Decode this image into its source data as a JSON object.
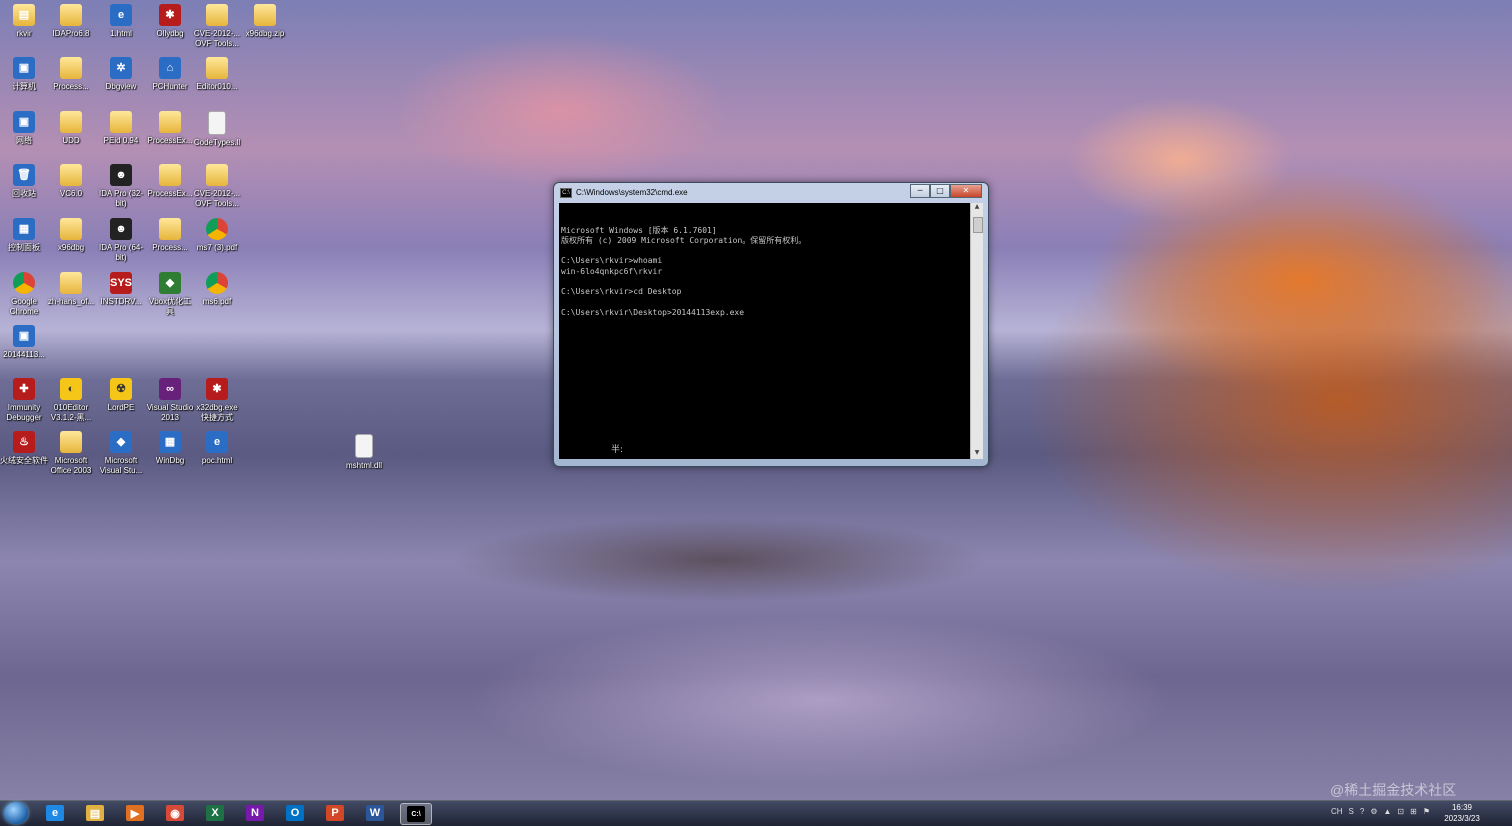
{
  "desktop": {
    "icons": [
      {
        "label": "rkvir",
        "glyph": "▤",
        "style": "folder"
      },
      {
        "label": "IDAPro6.8",
        "glyph": "",
        "style": "folder"
      },
      {
        "label": "1.html",
        "glyph": "e",
        "style": "app-blue"
      },
      {
        "label": "Ollydbg",
        "glyph": "✱",
        "style": "app-red"
      },
      {
        "label": "CVE-2012-... OVF Tools...",
        "glyph": "",
        "style": "folder"
      },
      {
        "label": "x96dbg.zip",
        "glyph": "",
        "style": "folder"
      },
      {
        "label": "计算机",
        "glyph": "▣",
        "style": "app-blue"
      },
      {
        "label": "Process...",
        "glyph": "",
        "style": "folder"
      },
      {
        "label": "Dbgview",
        "glyph": "✲",
        "style": "app-blue"
      },
      {
        "label": "PCHunter",
        "glyph": "⌂",
        "style": "app-blue"
      },
      {
        "label": "Editor010...",
        "glyph": "",
        "style": "folder"
      },
      {
        "label": "网络",
        "glyph": "▣",
        "style": "app-blue"
      },
      {
        "label": "UDD",
        "glyph": "",
        "style": "folder"
      },
      {
        "label": "PEid 0.94",
        "glyph": "",
        "style": "folder"
      },
      {
        "label": "ProcessEx...",
        "glyph": "",
        "style": "folder"
      },
      {
        "label": "CodeTypes.ll",
        "glyph": "",
        "style": "file"
      },
      {
        "label": "回收站",
        "glyph": "🗑",
        "style": "app-blue"
      },
      {
        "label": "VC6.0",
        "glyph": "",
        "style": "folder"
      },
      {
        "label": "IDA Pro (32-bit)",
        "glyph": "☻",
        "style": "app-dark"
      },
      {
        "label": "ProcessEx...",
        "glyph": "",
        "style": "folder"
      },
      {
        "label": "CVE-2012-... OVF Tools...",
        "glyph": "",
        "style": "folder"
      },
      {
        "label": "控制面板",
        "glyph": "▦",
        "style": "app-blue"
      },
      {
        "label": "x96dbg",
        "glyph": "",
        "style": "folder"
      },
      {
        "label": "IDA Pro (64-bit)",
        "glyph": "☻",
        "style": "app-dark"
      },
      {
        "label": "Process...",
        "glyph": "",
        "style": "folder"
      },
      {
        "label": "ms7 (3).pdf",
        "glyph": "",
        "style": "app-chrome"
      },
      {
        "label": "Google Chrome",
        "glyph": "",
        "style": "app-chrome"
      },
      {
        "label": "zh-hans_of...",
        "glyph": "",
        "style": "folder"
      },
      {
        "label": "INSTDRV...",
        "glyph": "SYS",
        "style": "app-red"
      },
      {
        "label": "Vbox优化工具",
        "glyph": "◆",
        "style": "app-green"
      },
      {
        "label": "ms6.pdf",
        "glyph": "",
        "style": "app-chrome"
      },
      {
        "label": "20144113...",
        "glyph": "▣",
        "style": "app-blue"
      },
      {
        "label": "Immunity Debugger",
        "glyph": "✚",
        "style": "app-red"
      },
      {
        "label": "010Editor V3.1.2-黑...",
        "glyph": "◐",
        "style": "app-yellow"
      },
      {
        "label": "LordPE",
        "glyph": "☢",
        "style": "app-yellow"
      },
      {
        "label": "Visual Studio 2013",
        "glyph": "∞",
        "style": "app-purple"
      },
      {
        "label": "x32dbg.exe 快捷方式",
        "glyph": "✱",
        "style": "app-red"
      },
      {
        "label": "火绒安全软件",
        "glyph": "♨",
        "style": "app-red"
      },
      {
        "label": "Microsoft Office 2003",
        "glyph": "",
        "style": "folder"
      },
      {
        "label": "Microsoft Visual Stu...",
        "glyph": "◆",
        "style": "app-blue"
      },
      {
        "label": "WinDbg",
        "glyph": "▦",
        "style": "app-blue"
      },
      {
        "label": "poc.html",
        "glyph": "e",
        "style": "app-blue"
      },
      {
        "label": "mshtml.dll",
        "glyph": "",
        "style": "file"
      }
    ]
  },
  "cmd": {
    "title": "C:\\Windows\\system32\\cmd.exe",
    "minimize": "─",
    "maximize": "□",
    "close": "✕",
    "lines": [
      "Microsoft Windows [版本 6.1.7601]",
      "版权所有 (c) 2009 Microsoft Corporation。保留所有权利。",
      "",
      "C:\\Users\\rkvir>whoami",
      "win-6lo4qnkpc6f\\rkvir",
      "",
      "C:\\Users\\rkvir>cd Desktop",
      "",
      "C:\\Users\\rkvir\\Desktop>20144113exp.exe"
    ],
    "ime": "半:"
  },
  "taskbar": {
    "apps": [
      {
        "name": "ie",
        "glyph": "e",
        "color": "#1e88e5"
      },
      {
        "name": "explorer",
        "glyph": "▤",
        "color": "#e0b040"
      },
      {
        "name": "media-player",
        "glyph": "▶",
        "color": "#e07020"
      },
      {
        "name": "chrome",
        "glyph": "◉",
        "color": "#d84a38"
      },
      {
        "name": "excel",
        "glyph": "X",
        "color": "#1e7145"
      },
      {
        "name": "onenote",
        "glyph": "N",
        "color": "#7719aa"
      },
      {
        "name": "outlook",
        "glyph": "O",
        "color": "#0072c6"
      },
      {
        "name": "powerpoint",
        "glyph": "P",
        "color": "#d24726"
      },
      {
        "name": "word",
        "glyph": "W",
        "color": "#2b579a"
      },
      {
        "name": "cmd",
        "glyph": "C:\\",
        "color": "#000000"
      }
    ],
    "tray": [
      "CH",
      "S",
      "?",
      "⚙",
      "▲",
      "⊡",
      "⊞",
      "⚑"
    ],
    "time": "16:39",
    "date": "2023/3/23"
  },
  "watermark": "@稀土掘金技术社区"
}
